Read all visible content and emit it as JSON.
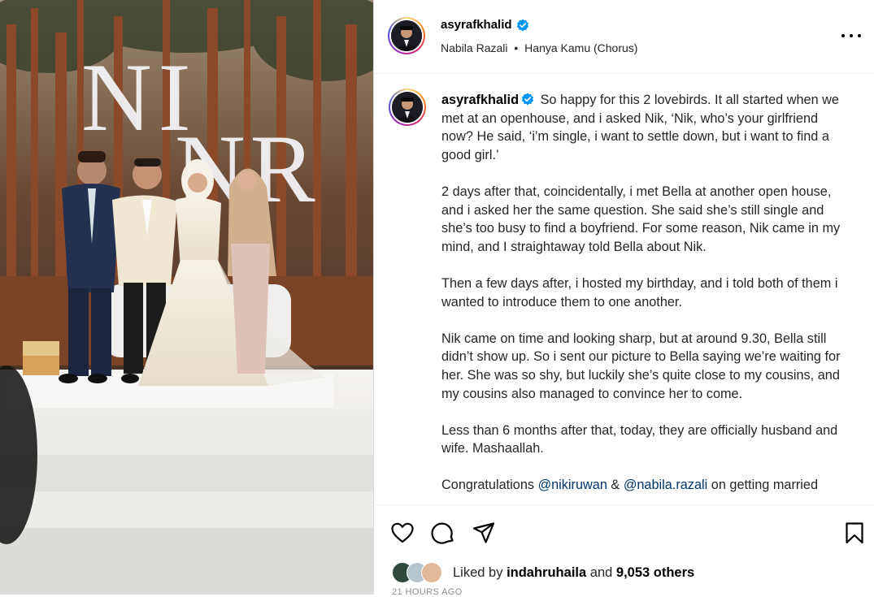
{
  "post": {
    "username": "asyrafkhalid",
    "audio": {
      "artist": "Nabila Razali",
      "separator": "•",
      "track": "Hanya Kamu (Chorus)"
    },
    "backdrop_monogram": {
      "line1": "NI",
      "line2": "NR"
    }
  },
  "caption": {
    "username": "asyrafkhalid",
    "intro": "So happy for this 2 lovebirds. It all started when we met at an openhouse, and i asked Nik, ‘Nik, who’s your girlfriend now? He said, ‘i’m single, i want to settle down, but i want to find a good girl.’",
    "paragraphs": [
      "2 days after that, coincidentally, i met Bella at another open house, and i asked her the same question. She said she’s still single and she’s too busy to find a boyfriend. For some reason, Nik came in my mind, and I straightaway told Bella about Nik.",
      "Then a few days after, i hosted my birthday, and i told both of them i wanted to introduce them to one another.",
      "Nik came on time and looking sharp, but at around 9.30, Bella still didn’t show up. So i sent our picture to Bella saying we’re waiting for her. She was so shy, but luckily she’s quite close to my cousins, and my cousins also managed to convince her to come.",
      "Less than 6 months after that, today, they are officially husband and wife. Mashaallah."
    ],
    "congrats": {
      "prefix": "Congratulations",
      "mention1": "@nikiruwan",
      "joiner": "&",
      "mention2": "@nabila.razali",
      "suffix": "on getting married"
    }
  },
  "actions": {
    "icons": [
      "heart-icon",
      "comment-icon",
      "share-icon",
      "bookmark-icon"
    ]
  },
  "likes": {
    "prefix": "Liked by",
    "user": "indahruhaila",
    "joiner": "and",
    "others": "9,053 others"
  },
  "timestamp": "21 HOURS AGO",
  "colors": {
    "verified": "#0095f6",
    "mention": "#00376b",
    "muted": "#8e8e8e"
  }
}
